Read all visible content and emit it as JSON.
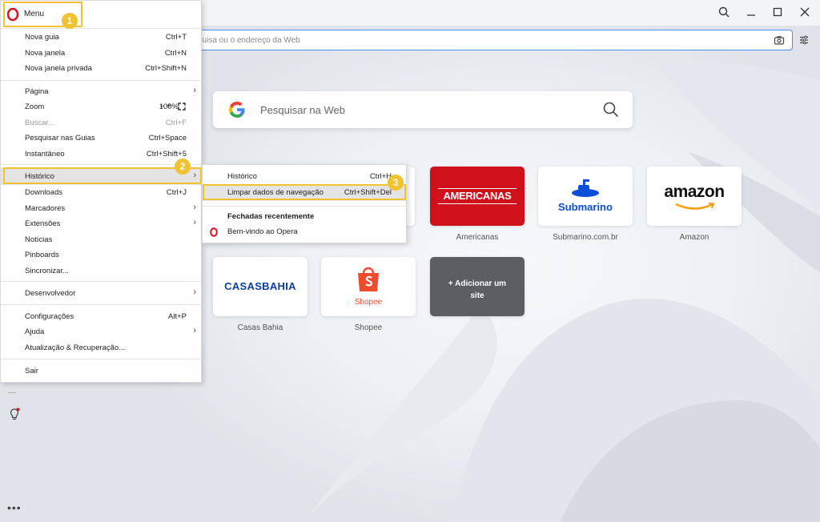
{
  "browser": {
    "address_placeholder": "quisa ou o endereço da Web",
    "search_placeholder": "Pesquisar na Web"
  },
  "speed_dial": [
    {
      "caption": "Americanas",
      "logo_text": "AMERICANAS"
    },
    {
      "caption": "Submarino.com.br",
      "logo_text": "Submarino"
    },
    {
      "caption": "Amazon",
      "logo_text": "amazon"
    },
    {
      "caption": "Casas Bahia",
      "logo_text": "CASASBAHIA"
    },
    {
      "caption": "Shopee",
      "logo_text": "Shopee"
    },
    {
      "caption": "",
      "logo_text": "+ Adicionar um site"
    }
  ],
  "menu": {
    "title": "Menu",
    "items": [
      {
        "label": "Nova guia",
        "shortcut": "Ctrl+T"
      },
      {
        "label": "Nova janela",
        "shortcut": "Ctrl+N"
      },
      {
        "label": "Nova janela privada",
        "shortcut": "Ctrl+Shift+N"
      },
      {
        "label": "Página",
        "shortcut": ""
      },
      {
        "label": "Zoom",
        "shortcut": ""
      },
      {
        "label": "Buscar...",
        "shortcut": "Ctrl+F"
      },
      {
        "label": "Pesquisar nas Guias",
        "shortcut": "Ctrl+Space"
      },
      {
        "label": "Instantâneo",
        "shortcut": "Ctrl+Shift+5"
      },
      {
        "label": "Histórico",
        "shortcut": ""
      },
      {
        "label": "Downloads",
        "shortcut": "Ctrl+J"
      },
      {
        "label": "Marcadores",
        "shortcut": ""
      },
      {
        "label": "Extensões",
        "shortcut": ""
      },
      {
        "label": "Notícias",
        "shortcut": ""
      },
      {
        "label": "Pinboards",
        "shortcut": ""
      },
      {
        "label": "Sincronizar...",
        "shortcut": ""
      },
      {
        "label": "Desenvolvedor",
        "shortcut": ""
      },
      {
        "label": "Configurações",
        "shortcut": "Alt+P"
      },
      {
        "label": "Ajuda",
        "shortcut": ""
      },
      {
        "label": "Atualização & Recuperação...",
        "shortcut": ""
      },
      {
        "label": "Sair",
        "shortcut": ""
      }
    ],
    "zoom": {
      "minus": "−",
      "value": "100%",
      "plus": "+"
    }
  },
  "submenu": {
    "items": [
      {
        "label": "Histórico",
        "shortcut": "Ctrl+H"
      },
      {
        "label": "Limpar dados de navegação",
        "shortcut": "Ctrl+Shift+Del"
      }
    ],
    "recent_heading": "Fechadas recentemente",
    "recent_items": [
      {
        "label": "Bem-vindo ao Opera"
      }
    ]
  },
  "annotations": [
    "1",
    "2",
    "3"
  ],
  "colors": {
    "highlight": "#f1c232",
    "opera_red": "#e0101a",
    "address_border": "#4f8ef7"
  }
}
